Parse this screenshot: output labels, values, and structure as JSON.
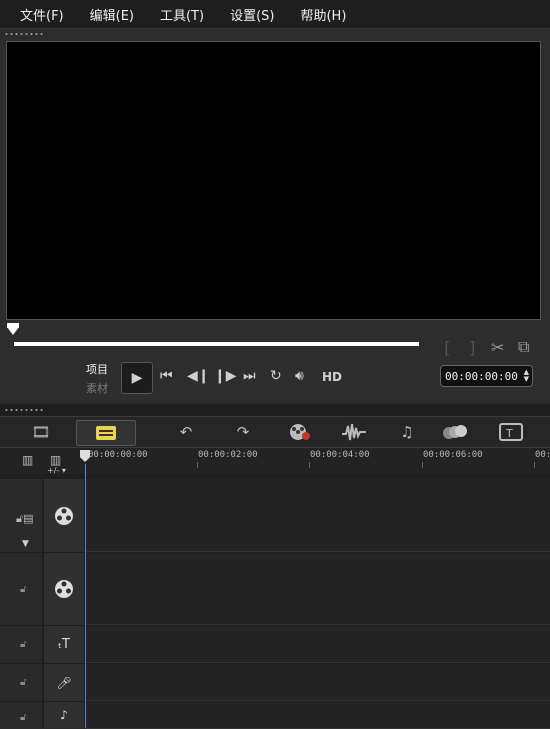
{
  "menu": {
    "items": [
      "文件(F)",
      "编辑(E)",
      "工具(T)",
      "设置(S)",
      "帮助(H)"
    ]
  },
  "player": {
    "mode_project": "项目",
    "mode_clip": "素材",
    "hd_label": "HD",
    "timecode": "00:00:00:00",
    "play_icon": "play-icon",
    "scrub_progress": 0
  },
  "timeline": {
    "add_remove_label": "+/- ▾",
    "ruler_ticks": [
      "00:00:00:00",
      "00:00:02:00",
      "00:00:04:00",
      "00:00:06:00",
      "00:0"
    ],
    "tracks": [
      {
        "name": "video-track",
        "icon": "film-reel-icon"
      },
      {
        "name": "overlay-track",
        "icon": "film-reel-icon"
      },
      {
        "name": "title-track",
        "icon": "title-T-icon"
      },
      {
        "name": "voice-track",
        "icon": "microphone-icon"
      },
      {
        "name": "music-track",
        "icon": "music-note-icon"
      }
    ]
  }
}
